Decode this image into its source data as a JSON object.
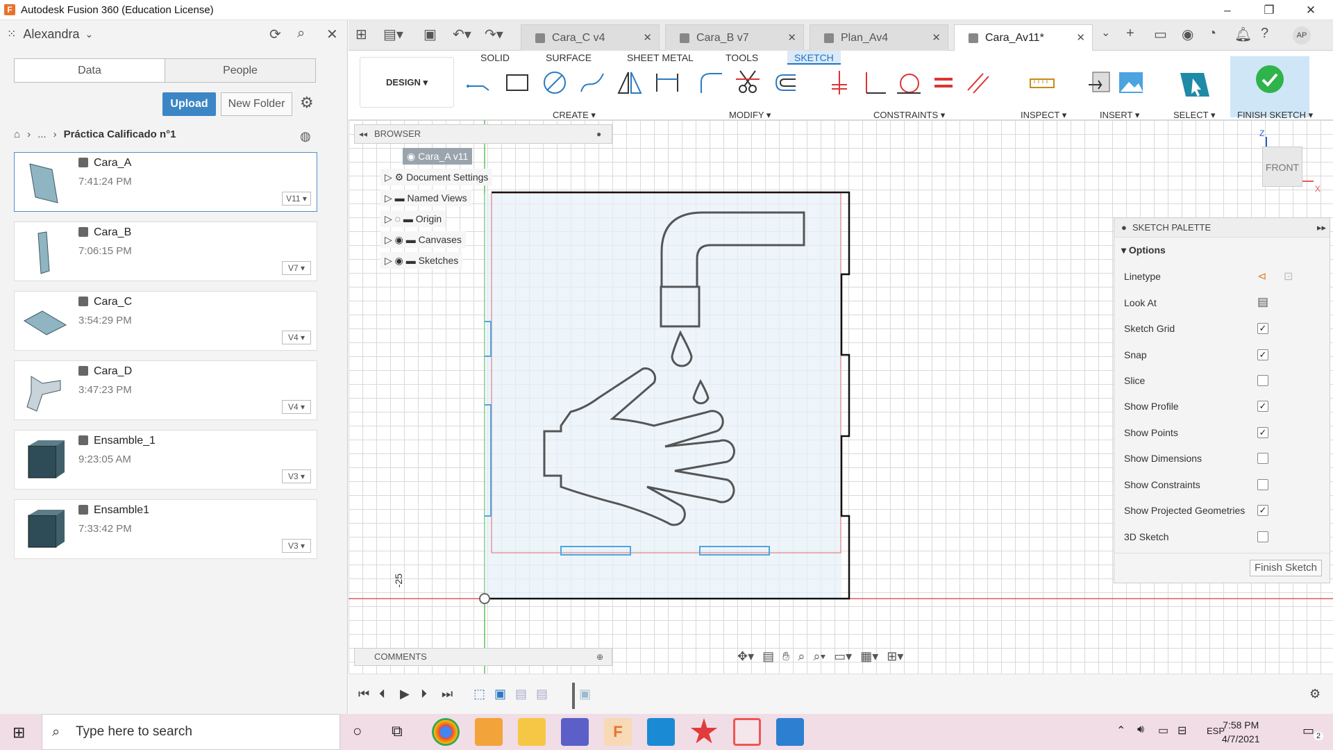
{
  "window": {
    "title": "Autodesk Fusion 360 (Education License)",
    "logo": "F"
  },
  "data_panel": {
    "user": "Alexandra",
    "tabs": [
      "Data",
      "People"
    ],
    "upload_label": "Upload",
    "new_folder_label": "New Folder",
    "breadcrumb": {
      "ellipsis": "...",
      "title": "Práctica Calificado n°1"
    },
    "files": [
      {
        "name": "Cara_A",
        "time": "7:41:24 PM",
        "version": "V11 ▾"
      },
      {
        "name": "Cara_B",
        "time": "7:06:15 PM",
        "version": "V7 ▾"
      },
      {
        "name": "Cara_C",
        "time": "3:54:29 PM",
        "version": "V4 ▾"
      },
      {
        "name": "Cara_D",
        "time": "3:47:23 PM",
        "version": "V4 ▾"
      },
      {
        "name": "Ensamble_1",
        "time": "9:23:05 AM",
        "version": "V3 ▾"
      },
      {
        "name": "Ensamble1",
        "time": "7:33:42 PM",
        "version": "V3 ▾"
      }
    ]
  },
  "doc_tabs": [
    {
      "label": "Cara_C v4"
    },
    {
      "label": "Cara_B v7"
    },
    {
      "label": "Plan_Av4"
    },
    {
      "label": "Cara_Av11*"
    }
  ],
  "user_initials": "AP",
  "ribbon": {
    "tabs": [
      "SOLID",
      "SURFACE",
      "SHEET METAL",
      "TOOLS",
      "SKETCH"
    ],
    "design_label": "DESIGN ▾",
    "groups": [
      "CREATE ▾",
      "MODIFY ▾",
      "CONSTRAINTS ▾",
      "INSPECT ▾",
      "INSERT ▾",
      "SELECT ▾",
      "FINISH SKETCH ▾"
    ]
  },
  "browser": {
    "title": "BROWSER",
    "root": "Cara_A v11",
    "items": [
      "Document Settings",
      "Named Views",
      "Origin",
      "Canvases",
      "Sketches"
    ]
  },
  "comments_label": "COMMENTS",
  "viewcube": {
    "face": "FRONT",
    "axis_z": "Z",
    "axis_x": "X"
  },
  "dimension_label": "-25",
  "palette": {
    "title": "SKETCH PALETTE",
    "options_label": "Options",
    "rows": [
      {
        "label": "Linetype",
        "checked": null
      },
      {
        "label": "Look At",
        "checked": null
      },
      {
        "label": "Sketch Grid",
        "checked": true
      },
      {
        "label": "Snap",
        "checked": true
      },
      {
        "label": "Slice",
        "checked": false
      },
      {
        "label": "Show Profile",
        "checked": true
      },
      {
        "label": "Show Points",
        "checked": true
      },
      {
        "label": "Show Dimensions",
        "checked": false
      },
      {
        "label": "Show Constraints",
        "checked": false
      },
      {
        "label": "Show Projected Geometries",
        "checked": true
      },
      {
        "label": "3D Sketch",
        "checked": false
      }
    ],
    "finish_label": "Finish Sketch"
  },
  "taskbar": {
    "search_placeholder": "Type here to search",
    "lang": "ESP",
    "time": "7:58 PM",
    "date": "4/7/2021",
    "notifications": "2"
  },
  "colors": {
    "accent": "#1b75c9",
    "upload": "#3c86c5",
    "finish": "#2fb34a",
    "taskbar": "#f1dde6"
  }
}
